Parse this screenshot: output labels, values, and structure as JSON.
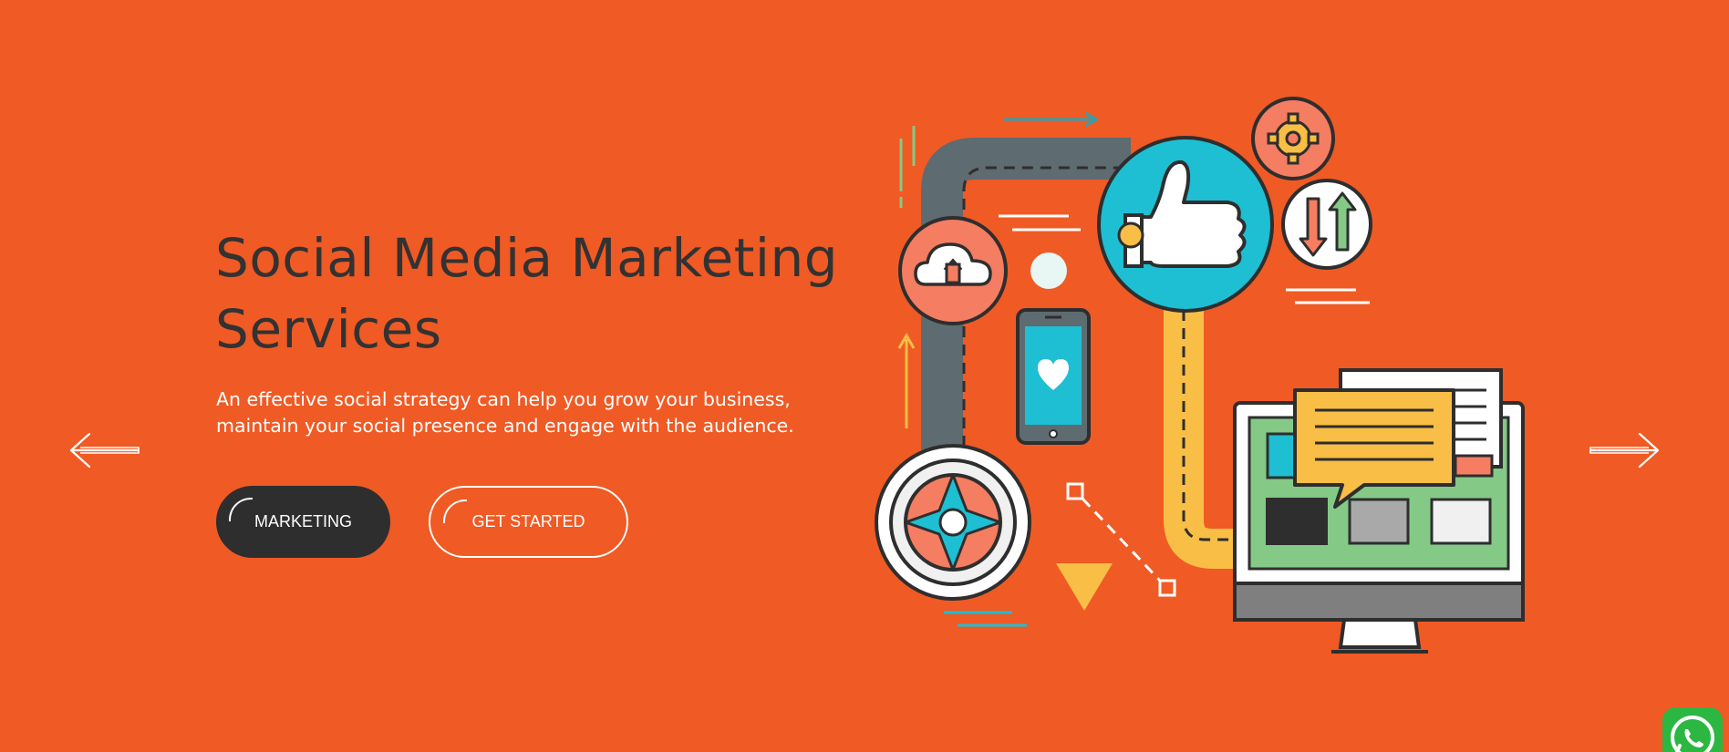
{
  "hero": {
    "title": "Social Media Marketing Services",
    "description": "An effective social strategy can help you grow your business, maintain your social presence and engage with the audience.",
    "buttons": {
      "marketing_label": "MARKETING",
      "get_started_label": "GET STARTED"
    }
  },
  "colors": {
    "background": "#F05A24",
    "title_text": "#333232",
    "dark_button": "#2E2E2E",
    "teal": "#1EBFD3",
    "yellow": "#F8BE45",
    "salmon": "#F47D62",
    "green": "#84C985",
    "whatsapp": "#2BB741"
  },
  "icons": {
    "prev": "arrow-left-icon",
    "next": "arrow-right-icon",
    "whatsapp": "whatsapp-icon"
  }
}
